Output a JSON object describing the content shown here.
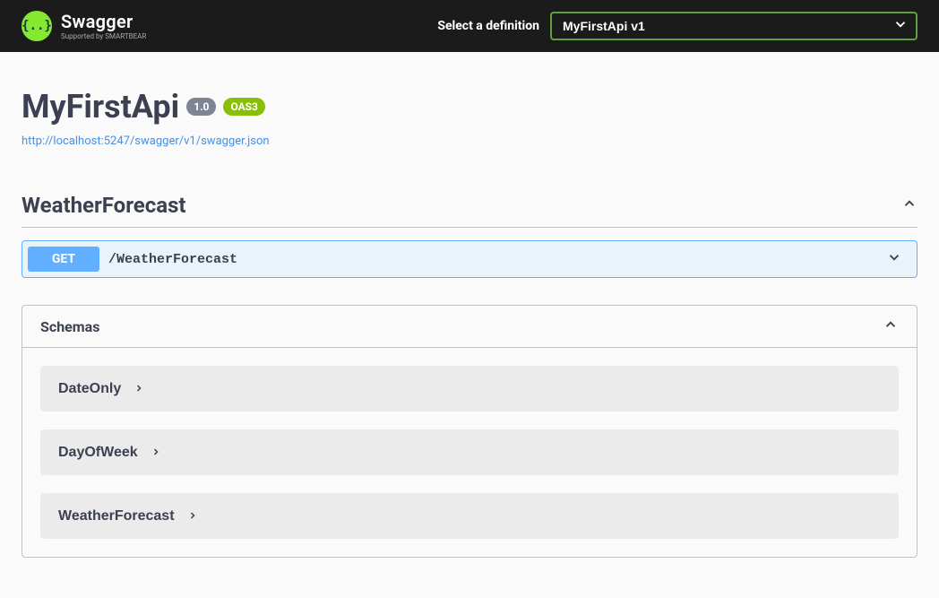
{
  "topbar": {
    "logo_text": "Swagger",
    "logo_sub": "Supported by SMARTBEAR",
    "select_label": "Select a definition",
    "selected_definition": "MyFirstApi v1"
  },
  "info": {
    "title": "MyFirstApi",
    "version": "1.0",
    "oas_badge": "OAS3",
    "spec_url": "http://localhost:5247/swagger/v1/swagger.json"
  },
  "tags": [
    {
      "name": "WeatherForecast",
      "operations": [
        {
          "method": "GET",
          "path": "/WeatherForecast"
        }
      ]
    }
  ],
  "schemas_title": "Schemas",
  "schemas": [
    {
      "name": "DateOnly"
    },
    {
      "name": "DayOfWeek"
    },
    {
      "name": "WeatherForecast"
    }
  ]
}
